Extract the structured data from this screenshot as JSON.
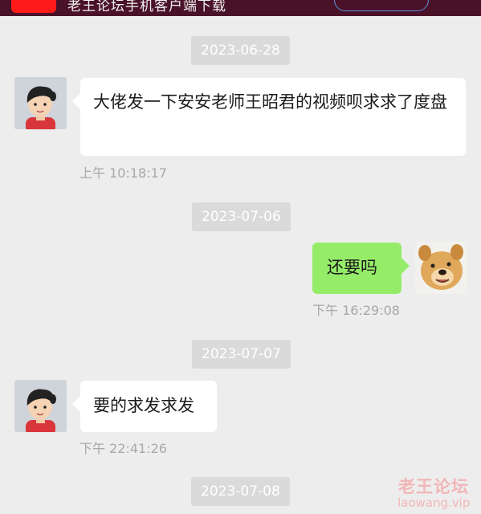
{
  "banner": {
    "text": "老王论坛手机客户端下载"
  },
  "messages": [
    {
      "date": "2023-06-28",
      "side": "in",
      "avatar": "boy-avatar",
      "text": "大佬发一下安安老师王昭君的视频呗求求了度盘",
      "time": "上午 10:18:17"
    },
    {
      "date": "2023-07-06",
      "side": "out",
      "avatar": "dog-avatar",
      "text": "还要吗",
      "time": "下午 16:29:08"
    },
    {
      "date": "2023-07-07",
      "side": "in",
      "avatar": "boy-avatar",
      "text": "要的求发求发",
      "time": "下午 22:41:26"
    },
    {
      "date": "2023-07-08"
    }
  ],
  "watermark": {
    "cn": "老王论坛",
    "en": "laowang.vip"
  },
  "colors": {
    "background": "#ededed",
    "incoming_bubble": "#ffffff",
    "outgoing_bubble": "#95ec69",
    "date_chip": "#dadada",
    "timestamp": "#a8a8a8"
  }
}
